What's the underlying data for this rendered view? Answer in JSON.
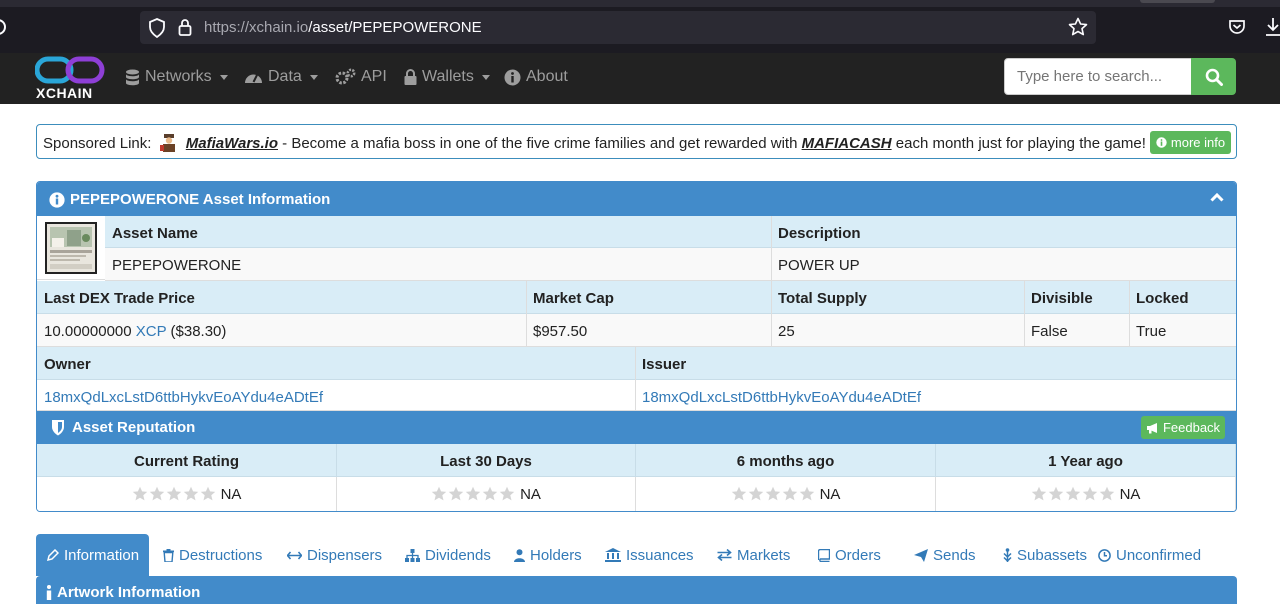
{
  "browser": {
    "url_host": "https://xchain.io",
    "url_path": "/asset/PEPEPOWERONE"
  },
  "nav": {
    "logo_text": "XCHAIN",
    "items": [
      {
        "label": "Networks",
        "icon": "database-icon",
        "has_caret": true
      },
      {
        "label": "Data",
        "icon": "dashboard-icon",
        "has_caret": true
      },
      {
        "label": "API",
        "icon": "cogs-icon",
        "has_caret": false
      },
      {
        "label": "Wallets",
        "icon": "lock-icon",
        "has_caret": true
      },
      {
        "label": "About",
        "icon": "info-circle-icon",
        "has_caret": false
      }
    ],
    "search_placeholder": "Type here to search..."
  },
  "sponsor": {
    "prefix": "Sponsored Link:",
    "site": "MafiaWars.io",
    "middle": " - Become a mafia boss in one of the five crime families and get rewarded with ",
    "token": "MAFIACASH",
    "suffix": " each month just for playing the game!",
    "button": "more info"
  },
  "asset": {
    "panel_title": "PEPEPOWERONE Asset Information",
    "asset_name_label": "Asset Name",
    "asset_name": "PEPEPOWERONE",
    "description_label": "Description",
    "description": "POWER UP",
    "last_trade_label": "Last DEX Trade Price",
    "last_trade_amount": "10.00000000",
    "last_trade_unit": "XCP",
    "last_trade_usd": "($38.30)",
    "market_cap_label": "Market Cap",
    "market_cap": "$957.50",
    "total_supply_label": "Total Supply",
    "total_supply": "25",
    "divisible_label": "Divisible",
    "divisible": "False",
    "locked_label": "Locked",
    "locked": "True",
    "owner_label": "Owner",
    "owner": "18mxQdLxcLstD6ttbHykvEoAYdu4eADtEf",
    "issuer_label": "Issuer",
    "issuer": "18mxQdLxcLstD6ttbHykvEoAYdu4eADtEf"
  },
  "reputation": {
    "title": "Asset Reputation",
    "feedback_button": "Feedback",
    "columns": [
      {
        "label": "Current Rating",
        "value": "NA",
        "stars": 0
      },
      {
        "label": "Last 30 Days",
        "value": "NA",
        "stars": 0
      },
      {
        "label": "6 months ago",
        "value": "NA",
        "stars": 0
      },
      {
        "label": "1 Year ago",
        "value": "NA",
        "stars": 0
      }
    ]
  },
  "tabs": [
    {
      "label": "Information",
      "active": true
    },
    {
      "label": "Destructions"
    },
    {
      "label": "Dispensers"
    },
    {
      "label": "Dividends"
    },
    {
      "label": "Holders"
    },
    {
      "label": "Issuances"
    },
    {
      "label": "Markets"
    },
    {
      "label": "Orders"
    },
    {
      "label": "Sends"
    },
    {
      "label": "Subassets"
    },
    {
      "label": "Unconfirmed"
    }
  ],
  "artwork": {
    "title": "Artwork Information"
  },
  "colors": {
    "primary": "#428bca",
    "success": "#5cb85c",
    "link": "#337ab7",
    "nav_bg": "#222222"
  }
}
